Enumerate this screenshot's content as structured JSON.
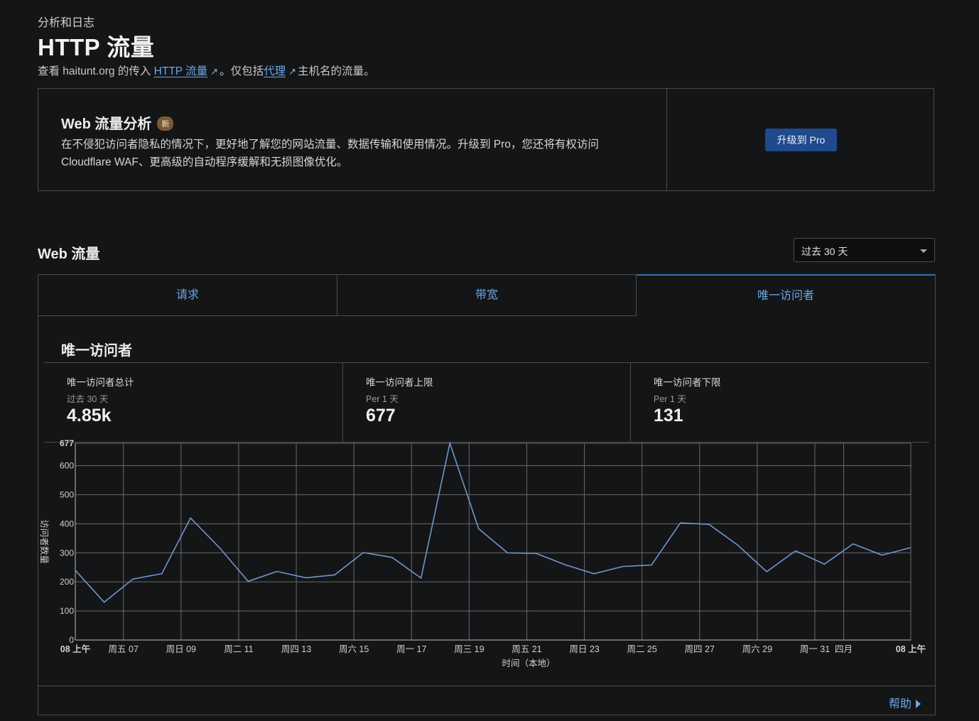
{
  "header": {
    "breadcrumb": "分析和日志",
    "title": "HTTP 流量",
    "subtitle_prefix": "查看 haitunt.org 的传入 ",
    "subtitle_link1": "HTTP 流量",
    "subtitle_mid": "。仅包括",
    "subtitle_link2": "代理",
    "subtitle_suffix": "主机名的流量。"
  },
  "promo": {
    "title": "Web 流量分析",
    "badge": "新",
    "description": "在不侵犯访问者隐私的情况下，更好地了解您的网站流量、数据传输和使用情况。升级到 Pro，您还将有权访问 Cloudflare WAF、更高级的自动程序缓解和无损图像优化。",
    "button": "升级到 Pro"
  },
  "web_traffic": {
    "title": "Web 流量",
    "range_selected": "过去 30 天",
    "tabs": [
      {
        "label": "请求"
      },
      {
        "label": "带宽"
      },
      {
        "label": "唯一访问者"
      }
    ],
    "active_tab": 2,
    "metric_title": "唯一访问者",
    "stats": [
      {
        "label": "唯一访问者总计",
        "period": "过去 30 天",
        "value": "4.85k"
      },
      {
        "label": "唯一访问者上限",
        "period": "Per 1 天",
        "value": "677"
      },
      {
        "label": "唯一访问者下限",
        "period": "Per 1 天",
        "value": "131"
      }
    ],
    "help": "帮助"
  },
  "colors": {
    "accent": "#6aa8e8",
    "line": "#6f97c9",
    "button_bg": "#1f4a8c",
    "badge_bg": "#7a5a36"
  },
  "chart_data": {
    "type": "line",
    "ylabel": "访问者数量",
    "xlabel": "时间（本地）",
    "ylim": [
      0,
      677
    ],
    "y_ticks": [
      0,
      100,
      200,
      300,
      400,
      500,
      600,
      677
    ],
    "x_tick_labels": [
      {
        "day": 0,
        "label": "08 上午",
        "bold": true
      },
      {
        "day": 1.67,
        "label": "周五 07"
      },
      {
        "day": 3.67,
        "label": "周日 09"
      },
      {
        "day": 5.67,
        "label": "周二 11"
      },
      {
        "day": 7.67,
        "label": "周四 13"
      },
      {
        "day": 9.67,
        "label": "周六 15"
      },
      {
        "day": 11.67,
        "label": "周一 17"
      },
      {
        "day": 13.67,
        "label": "周三 19"
      },
      {
        "day": 15.67,
        "label": "周五 21"
      },
      {
        "day": 17.67,
        "label": "周日 23"
      },
      {
        "day": 19.67,
        "label": "周二 25"
      },
      {
        "day": 21.67,
        "label": "周四 27"
      },
      {
        "day": 23.67,
        "label": "周六 29"
      },
      {
        "day": 25.67,
        "label": "周一 31"
      },
      {
        "day": 26.67,
        "label": "四月"
      },
      {
        "day": 29,
        "label": "08 上午",
        "bold": true
      }
    ],
    "grid": true,
    "series": [
      {
        "x": [
          0,
          1,
          2,
          3,
          4,
          5,
          6,
          7,
          8,
          9,
          10,
          11,
          12,
          13,
          14,
          15,
          16,
          17,
          18,
          19,
          20,
          21,
          22,
          23,
          24,
          25,
          26,
          27,
          28,
          29
        ],
        "values": [
          240,
          130,
          210,
          228,
          420,
          318,
          202,
          236,
          214,
          224,
          301,
          284,
          213,
          677,
          383,
          300,
          298,
          259,
          228,
          253,
          258,
          403,
          398,
          326,
          235,
          307,
          261,
          331,
          292,
          318
        ]
      }
    ]
  }
}
